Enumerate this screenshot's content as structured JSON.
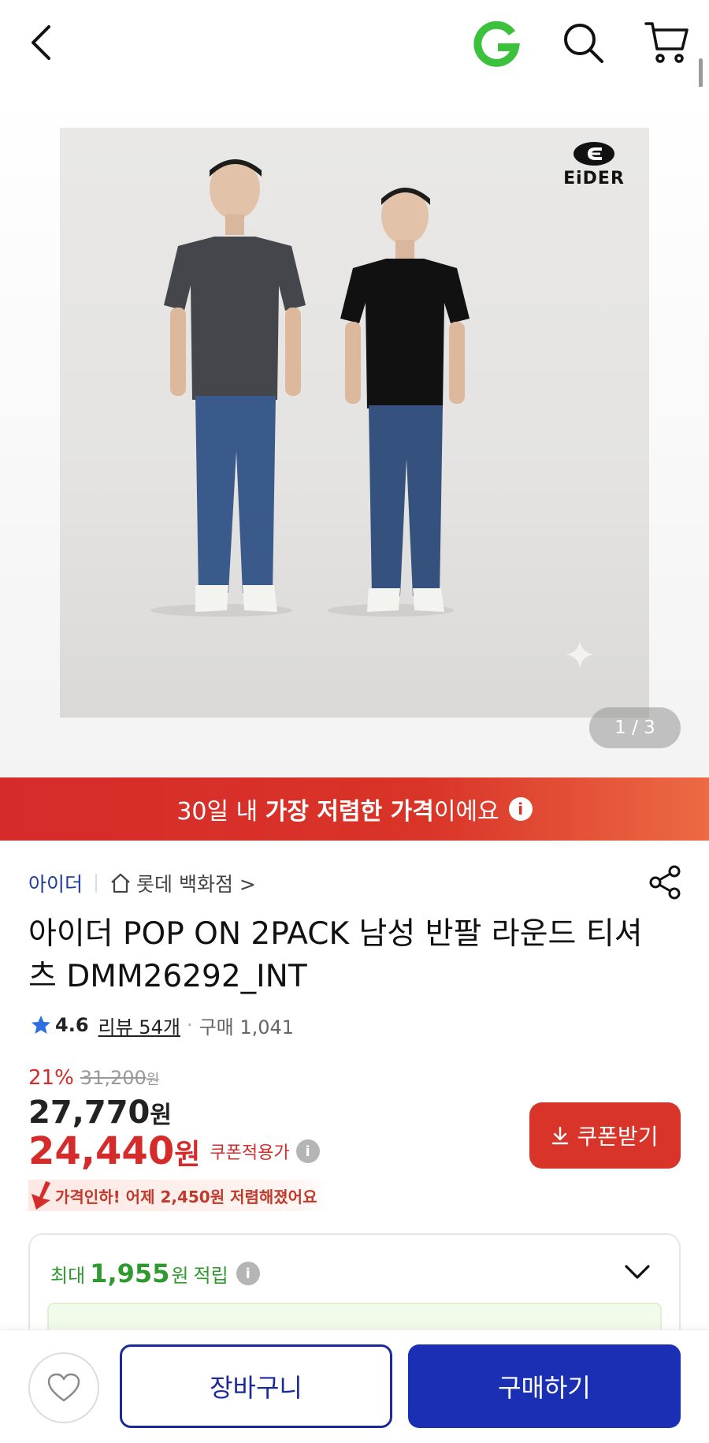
{
  "topbar": {
    "back_icon": "chevron-left-icon",
    "g_logo_icon": "g-logo-icon",
    "search_icon": "search-icon",
    "cart_icon": "cart-icon"
  },
  "gallery": {
    "brand_logo_text": "EiDER",
    "pager": "1 / 3",
    "image_index": 1,
    "image_count": 3
  },
  "price_banner": {
    "prefix": "30일 내 ",
    "strong": "가장 저렴한 가격",
    "suffix": "이에요",
    "info_glyph": "i",
    "bg_color": "#d62b2b"
  },
  "product": {
    "brand": "아이더",
    "store": "롯데 백화점",
    "store_chevron": ">",
    "title": "아이더 POP ON 2PACK 남성 반팔 라운드 티셔츠 DMM26292_INT",
    "rating": "4.6",
    "review_label": "리뷰 54개",
    "separator": "·",
    "purchase_label": "구매 1,041"
  },
  "price": {
    "discount_rate": "21%",
    "original_price": "31,200",
    "original_unit": "원",
    "sale_price": "27,770",
    "sale_unit": "원",
    "coupon_price": "24,440",
    "coupon_unit": "원",
    "coupon_applied_label": "쿠폰적용가",
    "help_glyph": "i",
    "drop_notice": "가격인하! 어제 2,450원 저렴해졌어요",
    "accent_color": "#d62b2b"
  },
  "coupon_button": {
    "label": "쿠폰받기",
    "icon": "download-icon"
  },
  "points": {
    "prefix": "최대",
    "amount": "1,955",
    "unit": "원",
    "suffix": "적립",
    "info_glyph": "i",
    "color": "#2e9a2e"
  },
  "bottom_bar": {
    "wishlist_icon": "heart-icon",
    "cart_label": "장바구니",
    "buy_label": "구매하기",
    "primary_color": "#1b2fb4"
  }
}
